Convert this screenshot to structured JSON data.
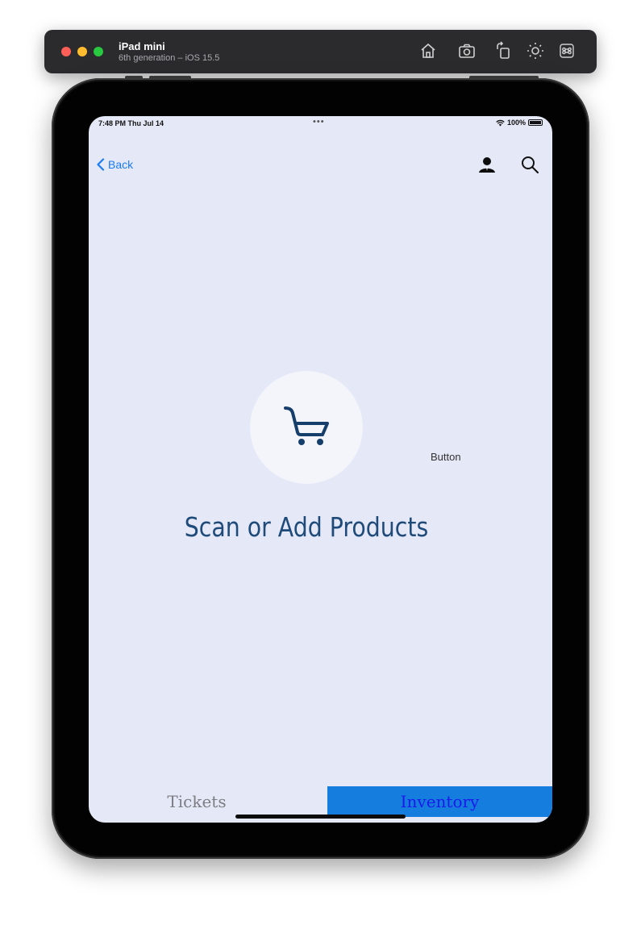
{
  "simulator": {
    "title": "iPad mini",
    "subtitle": "6th generation – iOS 15.5",
    "tools": [
      "home-icon",
      "screenshot-icon",
      "rotate-icon",
      "appearance-icon",
      "command-icon"
    ]
  },
  "status_bar": {
    "time": "7:48 PM  Thu Jul 14",
    "dots": "•••",
    "battery": "100%"
  },
  "nav": {
    "back_label": "Back",
    "accent_color": "#1a7bf2",
    "icons": [
      "user-icon",
      "search-icon"
    ]
  },
  "main": {
    "icon": "shopping-cart-icon",
    "button_label": "Button",
    "headline": "Scan or Add Products",
    "headline_color": "#1f4b7a"
  },
  "tabs": {
    "tickets_label": "Tickets",
    "inventory_label": "Inventory",
    "inventory_bg": "#157ddd"
  }
}
